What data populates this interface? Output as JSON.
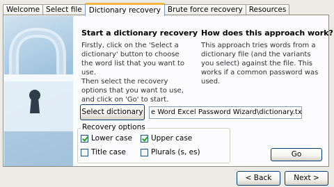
{
  "tabs": [
    {
      "label": "Welcome",
      "active": false
    },
    {
      "label": "Select file",
      "active": false
    },
    {
      "label": "Dictionary recovery",
      "active": true
    },
    {
      "label": "Brute force recovery",
      "active": false
    },
    {
      "label": "Resources",
      "active": false
    }
  ],
  "left": {
    "heading": "Start a dictionary recovery",
    "para1": "Firstly, click on the 'Select a dictionary' button to choose the word list that you want to use.",
    "para2": "Then select the recovery options that you want to use, and click on 'Go' to start."
  },
  "right": {
    "heading": "How does this approach work?",
    "para": "This approach tries words from a dictionary file (and the variants you select) against the file. This works if a common password was used."
  },
  "select_dictionary_label": "Select dictionary",
  "dictionary_path": "e Word Excel Password Wizard\\dictionary.txt",
  "options": {
    "group_label": "Recovery options",
    "lower_case": {
      "label": "Lower case",
      "checked": true
    },
    "upper_case": {
      "label": "Upper case",
      "checked": true
    },
    "title_case": {
      "label": "Title case",
      "checked": false
    },
    "plurals": {
      "label": "Plurals (s, es)",
      "checked": false
    }
  },
  "go_label": "Go",
  "nav": {
    "back_label": "< Back",
    "next_label": "Next >"
  },
  "colors": {
    "accent_tab": "#f7b441",
    "check_green": "#21a121",
    "button_border": "#003c74"
  }
}
